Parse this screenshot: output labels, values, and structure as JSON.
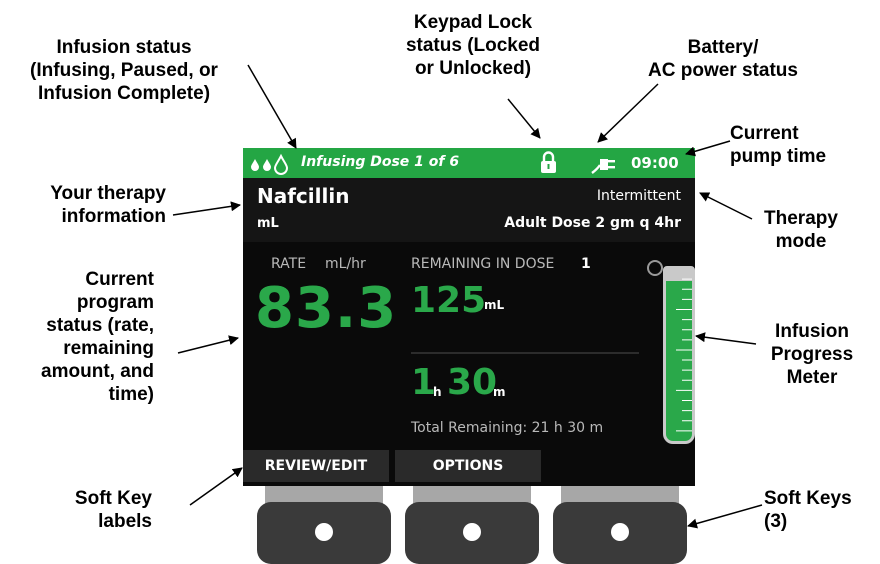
{
  "callouts": {
    "infusion_status": "Infusion status\n(Infusing, Paused, or\nInfusion Complete)",
    "keypad_lock": "Keypad Lock\nstatus (Locked\nor Unlocked)",
    "battery": "Battery/\nAC power status",
    "pump_time": "Current\npump time",
    "therapy_info": "Your therapy\ninformation",
    "therapy_mode": "Therapy\nmode",
    "program_status": "Current\nprogram\nstatus (rate,\nremaining\namount, and\ntime)",
    "progress_meter": "Infusion\nProgress\nMeter",
    "soft_key_labels": "Soft Key\nlabels",
    "soft_keys": "Soft Keys\n(3)"
  },
  "status_bar": {
    "status_text": "Infusing Dose 1 of 6",
    "time": "09:00",
    "icons": [
      "drops-icon",
      "lock-icon",
      "ac-plug-icon"
    ]
  },
  "therapy": {
    "drug": "Nafcillin",
    "unit": "mL",
    "mode": "Intermittent",
    "dose": "Adult Dose 2 gm q 4hr"
  },
  "program": {
    "rate_label": "RATE",
    "rate_unit": "mL/hr",
    "rate_value": "83.3",
    "remaining_label": "REMAINING IN DOSE",
    "remaining_dose_number": "1",
    "volume_value": "125",
    "volume_unit": "mL",
    "hours_value": "1",
    "hours_unit": "h",
    "minutes_value": "30",
    "minutes_unit": "m",
    "total_remaining": "Total Remaining: 21 h 30 m"
  },
  "progress_meter": {
    "fill_fraction": 0.93
  },
  "soft_key_labels": [
    "REVIEW/EDIT",
    "OPTIONS",
    ""
  ],
  "colors": {
    "status_green": "#24a644",
    "value_green": "#2aa84a",
    "screen_black": "#0a0a0a"
  }
}
